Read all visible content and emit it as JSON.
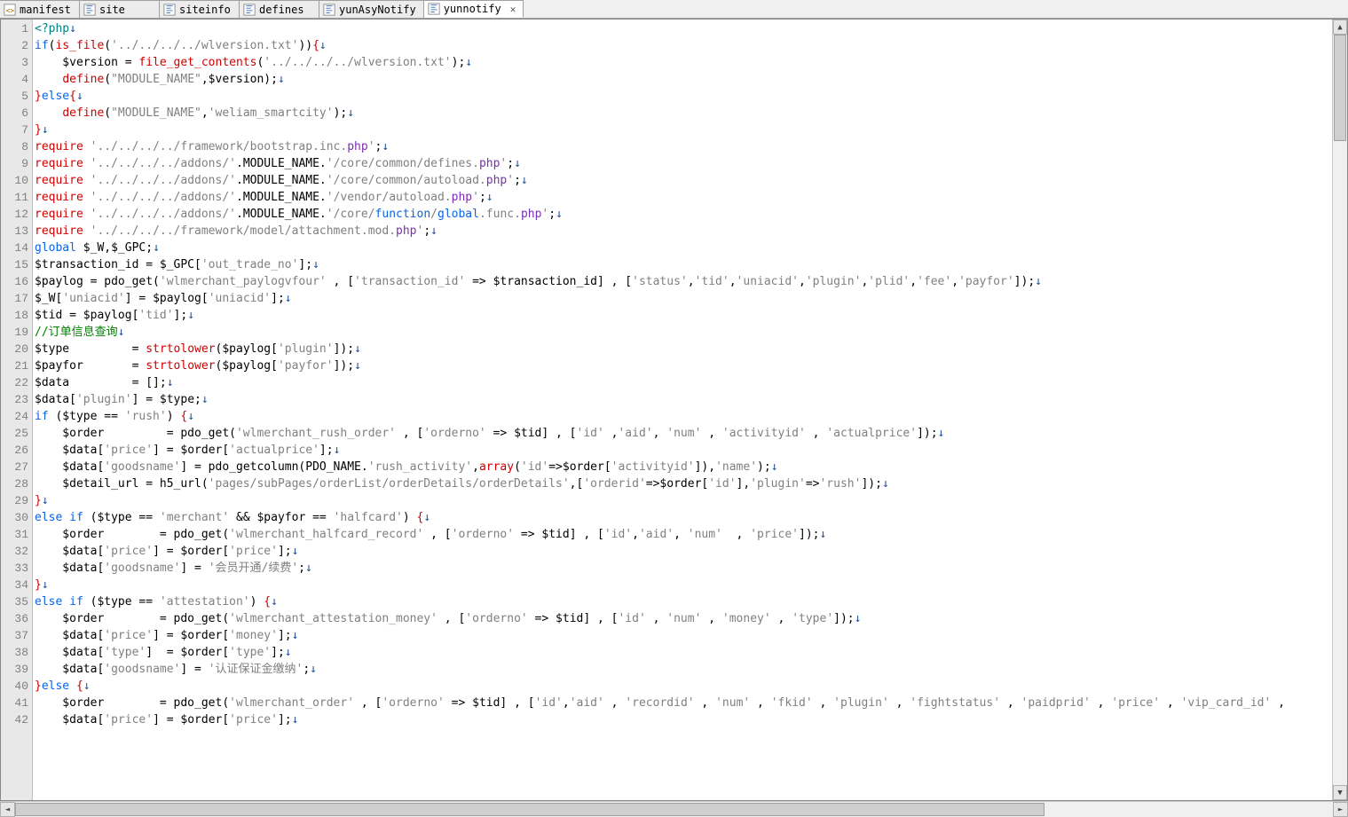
{
  "tabs": [
    {
      "label": "manifest",
      "icon": "xml"
    },
    {
      "label": "site",
      "icon": "php"
    },
    {
      "label": "siteinfo",
      "icon": "php"
    },
    {
      "label": "defines",
      "icon": "php"
    },
    {
      "label": "yunAsyNotify",
      "icon": "php"
    },
    {
      "label": "yunnotify",
      "icon": "php",
      "active": true
    }
  ],
  "line_start": 1,
  "line_end": 42,
  "code": [
    [
      [
        "teal",
        "<?php"
      ],
      [
        "arr",
        "↓"
      ]
    ],
    [
      [
        "kw",
        "if"
      ],
      [
        "var",
        "("
      ],
      [
        "red",
        "is_file"
      ],
      [
        "var",
        "("
      ],
      [
        "str",
        "'../../../../wlversion.txt'"
      ],
      [
        "var",
        "))"
      ],
      [
        "red",
        "{"
      ],
      [
        "arr",
        "↓"
      ]
    ],
    [
      [
        "var",
        "    $version = "
      ],
      [
        "red",
        "file_get_contents"
      ],
      [
        "var",
        "("
      ],
      [
        "str",
        "'../../../../wlversion.txt'"
      ],
      [
        "var",
        ");"
      ],
      [
        "arr",
        "↓"
      ]
    ],
    [
      [
        "var",
        "    "
      ],
      [
        "red",
        "define"
      ],
      [
        "var",
        "("
      ],
      [
        "str",
        "\"MODULE_NAME\""
      ],
      [
        "var",
        ",$version);"
      ],
      [
        "arr",
        "↓"
      ]
    ],
    [
      [
        "red",
        "}"
      ],
      [
        "kw",
        "else"
      ],
      [
        "red",
        "{"
      ],
      [
        "arr",
        "↓"
      ]
    ],
    [
      [
        "var",
        "    "
      ],
      [
        "red",
        "define"
      ],
      [
        "var",
        "("
      ],
      [
        "str",
        "\"MODULE_NAME\""
      ],
      [
        "var",
        ","
      ],
      [
        "str",
        "'weliam_smartcity'"
      ],
      [
        "var",
        ");"
      ],
      [
        "arr",
        "↓"
      ]
    ],
    [
      [
        "red",
        "}"
      ],
      [
        "arr",
        "↓"
      ]
    ],
    [
      [
        "red",
        "require"
      ],
      [
        "var",
        " "
      ],
      [
        "str",
        "'../../../../framework/bootstrap.inc."
      ],
      [
        "fn",
        "php"
      ],
      [
        "str",
        "'"
      ],
      [
        "var",
        ";"
      ],
      [
        "arr",
        "↓"
      ]
    ],
    [
      [
        "red",
        "require"
      ],
      [
        "var",
        " "
      ],
      [
        "str",
        "'../../../../addons/'"
      ],
      [
        "var",
        ".MODULE_NAME."
      ],
      [
        "str",
        "'/core/common/defines."
      ],
      [
        "fn",
        "php"
      ],
      [
        "str",
        "'"
      ],
      [
        "var",
        ";"
      ],
      [
        "arr",
        "↓"
      ]
    ],
    [
      [
        "red",
        "require"
      ],
      [
        "var",
        " "
      ],
      [
        "str",
        "'../../../../addons/'"
      ],
      [
        "var",
        ".MODULE_NAME."
      ],
      [
        "str",
        "'/core/common/autoload."
      ],
      [
        "fn",
        "php"
      ],
      [
        "str",
        "'"
      ],
      [
        "var",
        ";"
      ],
      [
        "arr",
        "↓"
      ]
    ],
    [
      [
        "red",
        "require"
      ],
      [
        "var",
        " "
      ],
      [
        "str",
        "'../../../../addons/'"
      ],
      [
        "var",
        ".MODULE_NAME."
      ],
      [
        "str",
        "'/vendor/autoload."
      ],
      [
        "fn",
        "php"
      ],
      [
        "str",
        "'"
      ],
      [
        "var",
        ";"
      ],
      [
        "arr",
        "↓"
      ]
    ],
    [
      [
        "red",
        "require"
      ],
      [
        "var",
        " "
      ],
      [
        "str",
        "'../../../../addons/'"
      ],
      [
        "var",
        ".MODULE_NAME."
      ],
      [
        "str",
        "'/core/"
      ],
      [
        "kw",
        "function"
      ],
      [
        "str",
        "/"
      ],
      [
        "kw",
        "global"
      ],
      [
        "str",
        ".func."
      ],
      [
        "fn",
        "php"
      ],
      [
        "str",
        "'"
      ],
      [
        "var",
        ";"
      ],
      [
        "arr",
        "↓"
      ]
    ],
    [
      [
        "red",
        "require"
      ],
      [
        "var",
        " "
      ],
      [
        "str",
        "'../../../../framework/model/attachment.mod."
      ],
      [
        "fn",
        "php"
      ],
      [
        "str",
        "'"
      ],
      [
        "var",
        ";"
      ],
      [
        "arr",
        "↓"
      ]
    ],
    [
      [
        "kw",
        "global"
      ],
      [
        "var",
        " $_W,$_GPC;"
      ],
      [
        "arr",
        "↓"
      ]
    ],
    [
      [
        "var",
        "$transaction_id = $_GPC["
      ],
      [
        "str",
        "'out_trade_no'"
      ],
      [
        "var",
        "];"
      ],
      [
        "arr",
        "↓"
      ]
    ],
    [
      [
        "var",
        "$paylog = pdo_get("
      ],
      [
        "str",
        "'wlmerchant_paylogvfour'"
      ],
      [
        "var",
        " , ["
      ],
      [
        "str",
        "'transaction_id'"
      ],
      [
        "var",
        " => $transaction_id] , ["
      ],
      [
        "str",
        "'status'"
      ],
      [
        "var",
        ","
      ],
      [
        "str",
        "'tid'"
      ],
      [
        "var",
        ","
      ],
      [
        "str",
        "'uniacid'"
      ],
      [
        "var",
        ","
      ],
      [
        "str",
        "'plugin'"
      ],
      [
        "var",
        ","
      ],
      [
        "str",
        "'plid'"
      ],
      [
        "var",
        ","
      ],
      [
        "str",
        "'fee'"
      ],
      [
        "var",
        ","
      ],
      [
        "str",
        "'payfor'"
      ],
      [
        "var",
        "]);"
      ],
      [
        "arr",
        "↓"
      ]
    ],
    [
      [
        "var",
        "$_W["
      ],
      [
        "str",
        "'uniacid'"
      ],
      [
        "var",
        "] = $paylog["
      ],
      [
        "str",
        "'uniacid'"
      ],
      [
        "var",
        "];"
      ],
      [
        "arr",
        "↓"
      ]
    ],
    [
      [
        "var",
        "$tid = $paylog["
      ],
      [
        "str",
        "'tid'"
      ],
      [
        "var",
        "];"
      ],
      [
        "arr",
        "↓"
      ]
    ],
    [
      [
        "grn",
        "//订单信息查询"
      ],
      [
        "arr",
        "↓"
      ]
    ],
    [
      [
        "var",
        "$type         = "
      ],
      [
        "red",
        "strtolower"
      ],
      [
        "var",
        "($paylog["
      ],
      [
        "str",
        "'plugin'"
      ],
      [
        "var",
        "]);"
      ],
      [
        "arr",
        "↓"
      ]
    ],
    [
      [
        "var",
        "$payfor       = "
      ],
      [
        "red",
        "strtolower"
      ],
      [
        "var",
        "($paylog["
      ],
      [
        "str",
        "'payfor'"
      ],
      [
        "var",
        "]);"
      ],
      [
        "arr",
        "↓"
      ]
    ],
    [
      [
        "var",
        "$data         = [];"
      ],
      [
        "arr",
        "↓"
      ]
    ],
    [
      [
        "var",
        "$data["
      ],
      [
        "str",
        "'plugin'"
      ],
      [
        "var",
        "] = $type;"
      ],
      [
        "arr",
        "↓"
      ]
    ],
    [
      [
        "kw",
        "if"
      ],
      [
        "var",
        " ($type == "
      ],
      [
        "str",
        "'rush'"
      ],
      [
        "var",
        ") "
      ],
      [
        "red",
        "{"
      ],
      [
        "arr",
        "↓"
      ]
    ],
    [
      [
        "var",
        "    $order         = pdo_get("
      ],
      [
        "str",
        "'wlmerchant_rush_order'"
      ],
      [
        "var",
        " , ["
      ],
      [
        "str",
        "'orderno'"
      ],
      [
        "var",
        " => $tid] , ["
      ],
      [
        "str",
        "'id'"
      ],
      [
        "var",
        " ,"
      ],
      [
        "str",
        "'aid'"
      ],
      [
        "var",
        ", "
      ],
      [
        "str",
        "'num'"
      ],
      [
        "var",
        " , "
      ],
      [
        "str",
        "'activityid'"
      ],
      [
        "var",
        " , "
      ],
      [
        "str",
        "'actualprice'"
      ],
      [
        "var",
        "]);"
      ],
      [
        "arr",
        "↓"
      ]
    ],
    [
      [
        "var",
        "    $data["
      ],
      [
        "str",
        "'price'"
      ],
      [
        "var",
        "] = $order["
      ],
      [
        "str",
        "'actualprice'"
      ],
      [
        "var",
        "];"
      ],
      [
        "arr",
        "↓"
      ]
    ],
    [
      [
        "var",
        "    $data["
      ],
      [
        "str",
        "'goodsname'"
      ],
      [
        "var",
        "] = pdo_getcolumn(PDO_NAME."
      ],
      [
        "str",
        "'rush_activity'"
      ],
      [
        "var",
        ","
      ],
      [
        "red",
        "array"
      ],
      [
        "var",
        "("
      ],
      [
        "str",
        "'id'"
      ],
      [
        "var",
        "=>$order["
      ],
      [
        "str",
        "'activityid'"
      ],
      [
        "var",
        "]),"
      ],
      [
        "str",
        "'name'"
      ],
      [
        "var",
        ");"
      ],
      [
        "arr",
        "↓"
      ]
    ],
    [
      [
        "var",
        "    $detail_url = h5_url("
      ],
      [
        "str",
        "'pages/subPages/orderList/orderDetails/orderDetails'"
      ],
      [
        "var",
        ",["
      ],
      [
        "str",
        "'orderid'"
      ],
      [
        "var",
        "=>$order["
      ],
      [
        "str",
        "'id'"
      ],
      [
        "var",
        "],"
      ],
      [
        "str",
        "'plugin'"
      ],
      [
        "var",
        "=>"
      ],
      [
        "str",
        "'rush'"
      ],
      [
        "var",
        "]);"
      ],
      [
        "arr",
        "↓"
      ]
    ],
    [
      [
        "red",
        "}"
      ],
      [
        "arr",
        "↓"
      ]
    ],
    [
      [
        "kw",
        "else if"
      ],
      [
        "var",
        " ($type == "
      ],
      [
        "str",
        "'merchant'"
      ],
      [
        "var",
        " && $payfor == "
      ],
      [
        "str",
        "'halfcard'"
      ],
      [
        "var",
        ") "
      ],
      [
        "red",
        "{"
      ],
      [
        "arr",
        "↓"
      ]
    ],
    [
      [
        "var",
        "    $order        = pdo_get("
      ],
      [
        "str",
        "'wlmerchant_halfcard_record'"
      ],
      [
        "var",
        " , ["
      ],
      [
        "str",
        "'orderno'"
      ],
      [
        "var",
        " => $tid] , ["
      ],
      [
        "str",
        "'id'"
      ],
      [
        "var",
        ","
      ],
      [
        "str",
        "'aid'"
      ],
      [
        "var",
        ", "
      ],
      [
        "str",
        "'num'"
      ],
      [
        "var",
        "  , "
      ],
      [
        "str",
        "'price'"
      ],
      [
        "var",
        "]);"
      ],
      [
        "arr",
        "↓"
      ]
    ],
    [
      [
        "var",
        "    $data["
      ],
      [
        "str",
        "'price'"
      ],
      [
        "var",
        "] = $order["
      ],
      [
        "str",
        "'price'"
      ],
      [
        "var",
        "];"
      ],
      [
        "arr",
        "↓"
      ]
    ],
    [
      [
        "var",
        "    $data["
      ],
      [
        "str",
        "'goodsname'"
      ],
      [
        "var",
        "] = "
      ],
      [
        "str",
        "'会员开通/续费'"
      ],
      [
        "var",
        ";"
      ],
      [
        "arr",
        "↓"
      ]
    ],
    [
      [
        "red",
        "}"
      ],
      [
        "arr",
        "↓"
      ]
    ],
    [
      [
        "kw",
        "else if"
      ],
      [
        "var",
        " ($type == "
      ],
      [
        "str",
        "'attestation'"
      ],
      [
        "var",
        ") "
      ],
      [
        "red",
        "{"
      ],
      [
        "arr",
        "↓"
      ]
    ],
    [
      [
        "var",
        "    $order        = pdo_get("
      ],
      [
        "str",
        "'wlmerchant_attestation_money'"
      ],
      [
        "var",
        " , ["
      ],
      [
        "str",
        "'orderno'"
      ],
      [
        "var",
        " => $tid] , ["
      ],
      [
        "str",
        "'id'"
      ],
      [
        "var",
        " , "
      ],
      [
        "str",
        "'num'"
      ],
      [
        "var",
        " , "
      ],
      [
        "str",
        "'money'"
      ],
      [
        "var",
        " , "
      ],
      [
        "str",
        "'type'"
      ],
      [
        "var",
        "]);"
      ],
      [
        "arr",
        "↓"
      ]
    ],
    [
      [
        "var",
        "    $data["
      ],
      [
        "str",
        "'price'"
      ],
      [
        "var",
        "] = $order["
      ],
      [
        "str",
        "'money'"
      ],
      [
        "var",
        "];"
      ],
      [
        "arr",
        "↓"
      ]
    ],
    [
      [
        "var",
        "    $data["
      ],
      [
        "str",
        "'type'"
      ],
      [
        "var",
        "]  = $order["
      ],
      [
        "str",
        "'type'"
      ],
      [
        "var",
        "];"
      ],
      [
        "arr",
        "↓"
      ]
    ],
    [
      [
        "var",
        "    $data["
      ],
      [
        "str",
        "'goodsname'"
      ],
      [
        "var",
        "] = "
      ],
      [
        "str",
        "'认证保证金缴纳'"
      ],
      [
        "var",
        ";"
      ],
      [
        "arr",
        "↓"
      ]
    ],
    [
      [
        "red",
        "}"
      ],
      [
        "kw",
        "else"
      ],
      [
        "var",
        " "
      ],
      [
        "red",
        "{"
      ],
      [
        "arr",
        "↓"
      ]
    ],
    [
      [
        "var",
        "    $order        = pdo_get("
      ],
      [
        "str",
        "'wlmerchant_order'"
      ],
      [
        "var",
        " , ["
      ],
      [
        "str",
        "'orderno'"
      ],
      [
        "var",
        " => $tid] , ["
      ],
      [
        "str",
        "'id'"
      ],
      [
        "var",
        ","
      ],
      [
        "str",
        "'aid'"
      ],
      [
        "var",
        " , "
      ],
      [
        "str",
        "'recordid'"
      ],
      [
        "var",
        " , "
      ],
      [
        "str",
        "'num'"
      ],
      [
        "var",
        " , "
      ],
      [
        "str",
        "'fkid'"
      ],
      [
        "var",
        " , "
      ],
      [
        "str",
        "'plugin'"
      ],
      [
        "var",
        " , "
      ],
      [
        "str",
        "'fightstatus'"
      ],
      [
        "var",
        " , "
      ],
      [
        "str",
        "'paidprid'"
      ],
      [
        "var",
        " , "
      ],
      [
        "str",
        "'price'"
      ],
      [
        "var",
        " , "
      ],
      [
        "str",
        "'vip_card_id'"
      ],
      [
        "var",
        " , "
      ]
    ],
    [
      [
        "var",
        "    $data["
      ],
      [
        "str",
        "'price'"
      ],
      [
        "var",
        "] = $order["
      ],
      [
        "str",
        "'price'"
      ],
      [
        "var",
        "];"
      ],
      [
        "arr",
        "↓"
      ]
    ]
  ]
}
